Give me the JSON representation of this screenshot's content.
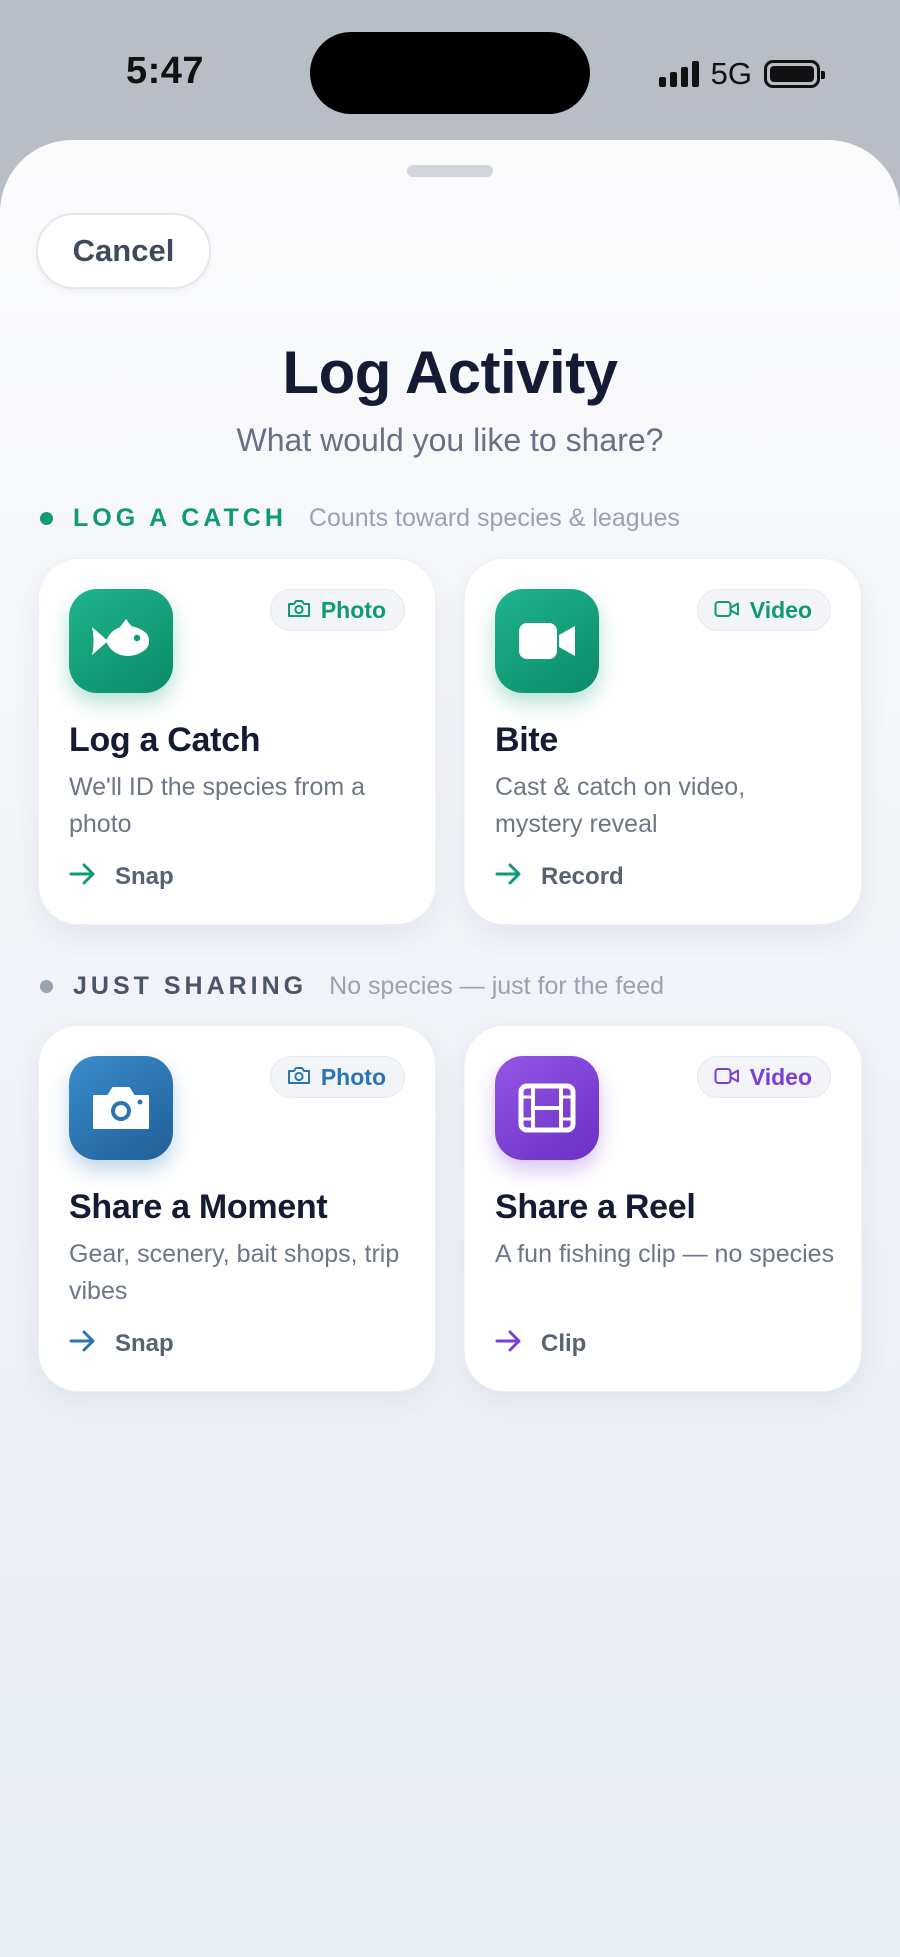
{
  "status_bar": {
    "time": "5:47",
    "network": "5G"
  },
  "header": {
    "cancel_label": "Cancel",
    "title": "Log Activity",
    "subtitle": "What would you like to share?"
  },
  "colors": {
    "green": "#0f9a76",
    "blue": "#2a74b3",
    "purple": "#7c3fd6",
    "gray_dot": "#9aa1b0"
  },
  "sections": [
    {
      "label": "LOG A CATCH",
      "description": "Counts toward species & leagues",
      "cards": [
        {
          "badge": "Photo",
          "badge_icon": "camera-icon",
          "icon": "fish-icon",
          "title": "Log a Catch",
          "description": "We'll ID the species from a photo",
          "action": "Snap"
        },
        {
          "badge": "Video",
          "badge_icon": "video-icon",
          "icon": "video-camera-icon",
          "title": "Bite",
          "description": "Cast & catch on video, mystery reveal",
          "action": "Record"
        }
      ]
    },
    {
      "label": "JUST SHARING",
      "description": "No species — just for the feed",
      "cards": [
        {
          "badge": "Photo",
          "badge_icon": "camera-icon",
          "icon": "camera-icon",
          "title": "Share a Moment",
          "description": "Gear, scenery, bait shops, trip vibes",
          "action": "Snap"
        },
        {
          "badge": "Video",
          "badge_icon": "video-icon",
          "icon": "film-icon",
          "title": "Share a Reel",
          "description": "A fun fishing clip — no species",
          "action": "Clip"
        }
      ]
    }
  ]
}
